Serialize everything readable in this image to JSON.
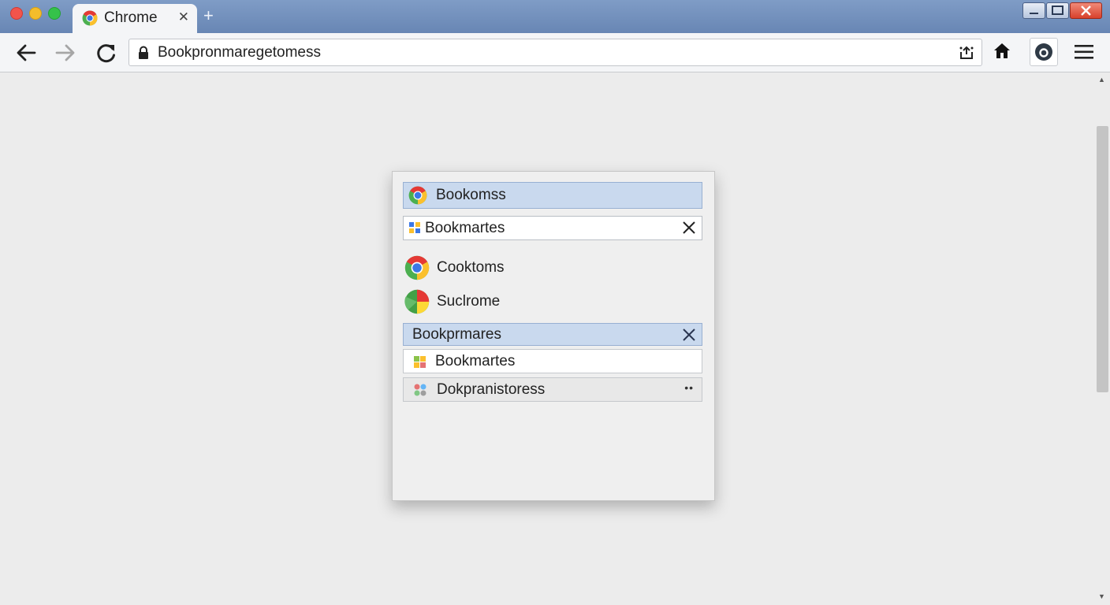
{
  "browser": {
    "tab_title": "Chrome",
    "tab_close": "✕",
    "new_tab": "+",
    "address_url": "Bookpronmaregetomess"
  },
  "icons": {
    "back": "back-arrow-icon",
    "forward": "forward-arrow-icon",
    "reload": "reload-icon",
    "lock": "lock-icon",
    "bookmark_star": "bookmark-star-icon",
    "home": "home-icon",
    "profile": "profile-icon",
    "menu": "hamburger-menu-icon"
  },
  "panel": {
    "header_label": "Bookomss",
    "search_value": "Bookmartes",
    "items": [
      {
        "label": "Cooktoms"
      },
      {
        "label": "Suclrome"
      }
    ],
    "folder_label": "Bookprmares",
    "folder_items": [
      {
        "label": "Bookmartes"
      },
      {
        "label": "Dokpranistoress",
        "more": "••"
      }
    ]
  },
  "colors": {
    "titlebar": "#7290bd",
    "selection": "#c9d9ee",
    "close_button": "#e05a44"
  }
}
